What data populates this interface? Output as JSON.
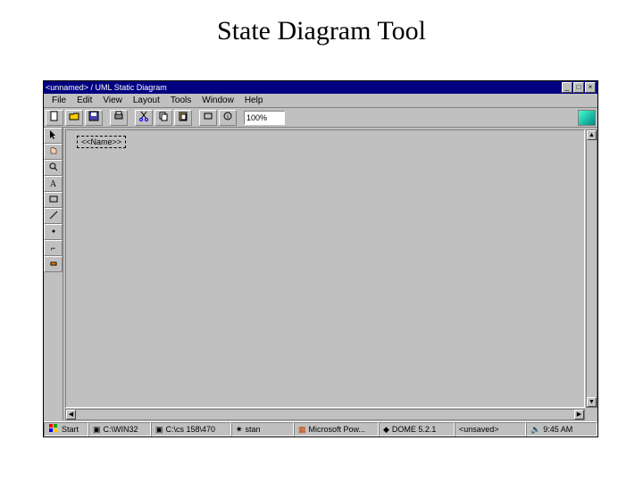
{
  "slide": {
    "title": "State Diagram Tool"
  },
  "window": {
    "title": "<unnamed> / UML Static Diagram",
    "controls": {
      "min": "_",
      "max": "□",
      "close": "×"
    }
  },
  "menu": {
    "file": "File",
    "edit": "Edit",
    "view": "View",
    "layout": "Layout",
    "tools": "Tools",
    "window": "Window",
    "help": "Help"
  },
  "toolbar": {
    "zoom_value": "100%"
  },
  "canvas": {
    "node_label": "<<Name>>"
  },
  "taskbar": {
    "start": "Start",
    "item1": "C:\\WIN32",
    "item2": "C:\\cs 158\\470",
    "item3": "stan",
    "item4": "Microsoft Pow...",
    "item5": "DOME 5.2.1",
    "item6": "<unsaved>",
    "clock": "9:45 AM"
  }
}
